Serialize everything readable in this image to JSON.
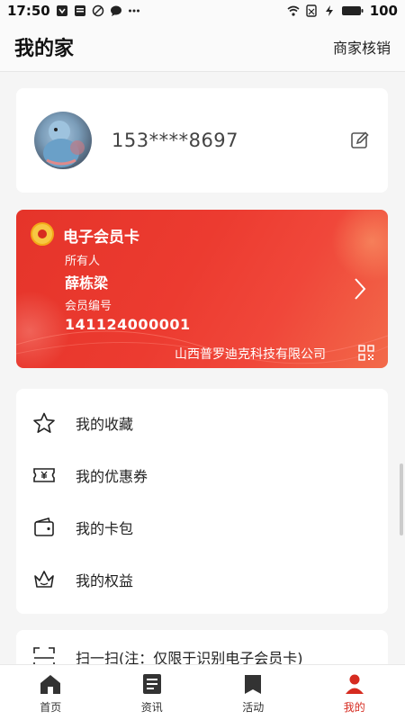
{
  "status_bar": {
    "time": "17:50",
    "battery": "100",
    "icons": [
      "app-notification-icon",
      "info-icon",
      "disabled-icon",
      "chat-icon",
      "more-dots-icon",
      "wifi-icon",
      "no-sim-icon",
      "charging-icon",
      "battery-icon"
    ]
  },
  "header": {
    "title": "我的家",
    "merchant_label": "商家核销"
  },
  "profile": {
    "phone": "153****8697",
    "avatar_icon": "user-avatar",
    "edit_icon": "edit-icon"
  },
  "member_card": {
    "title": "电子会员卡",
    "owner_label": "所有人",
    "owner_name": "薛栋梁",
    "number_label": "会员编号",
    "number": "141124000001",
    "company": "山西普罗迪克科技有限公司",
    "accent": "#e5342a"
  },
  "menu": {
    "items": [
      {
        "label": "我的收藏",
        "icon": "star-icon"
      },
      {
        "label": "我的优惠券",
        "icon": "coupon-icon"
      },
      {
        "label": "我的卡包",
        "icon": "wallet-icon"
      },
      {
        "label": "我的权益",
        "icon": "crown-icon"
      }
    ]
  },
  "scan": {
    "label": "扫一扫(注：仅限于识别电子会员卡)",
    "icon": "scan-icon"
  },
  "bottom_nav": {
    "items": [
      {
        "label": "首页",
        "icon": "home-icon"
      },
      {
        "label": "资讯",
        "icon": "news-icon"
      },
      {
        "label": "活动",
        "icon": "activity-icon"
      },
      {
        "label": "我的",
        "icon": "user-icon"
      }
    ]
  }
}
